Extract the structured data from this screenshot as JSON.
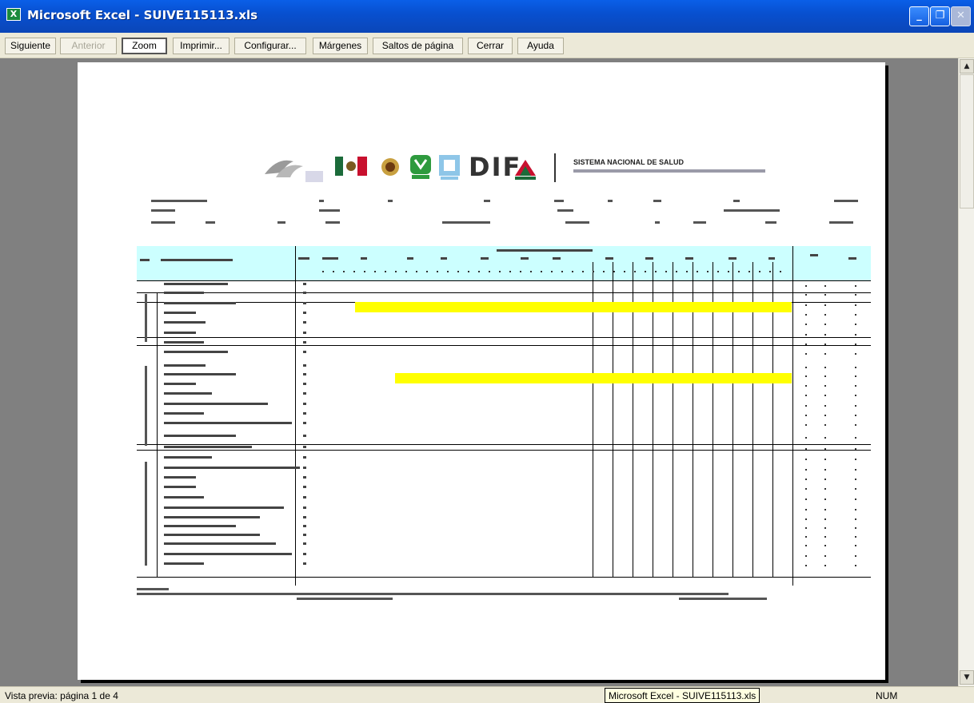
{
  "window": {
    "title": "Microsoft Excel - SUIVE115113.xls",
    "app_icon_glyph": "X",
    "controls": {
      "minimize": "_",
      "maximize": "❐",
      "close": "✕"
    }
  },
  "toolbar": {
    "buttons": [
      {
        "label": "Siguiente",
        "enabled": true
      },
      {
        "label": "Anterior",
        "enabled": false
      },
      {
        "label": "Zoom",
        "enabled": true,
        "pressed": true
      },
      {
        "label": "Imprimir...",
        "enabled": true
      },
      {
        "label": "Configurar...",
        "enabled": true
      },
      {
        "label": "Márgenes",
        "enabled": true
      },
      {
        "label": "Saltos de página",
        "enabled": true
      },
      {
        "label": "Cerrar",
        "enabled": true
      },
      {
        "label": "Ayuda",
        "enabled": true
      }
    ]
  },
  "scrollbar": {
    "up_glyph": "▲",
    "down_glyph": "▼"
  },
  "document": {
    "logo_dif": "DIF",
    "system_title": "SISTEMA NACIONAL DE SALUD",
    "highlight_color": "#ffff00",
    "header_band_color": "#ccffff"
  },
  "status": {
    "left": "Vista previa: página 1 de 4",
    "tooltip": "Microsoft Excel - SUIVE115113.xls",
    "num": "NUM"
  }
}
